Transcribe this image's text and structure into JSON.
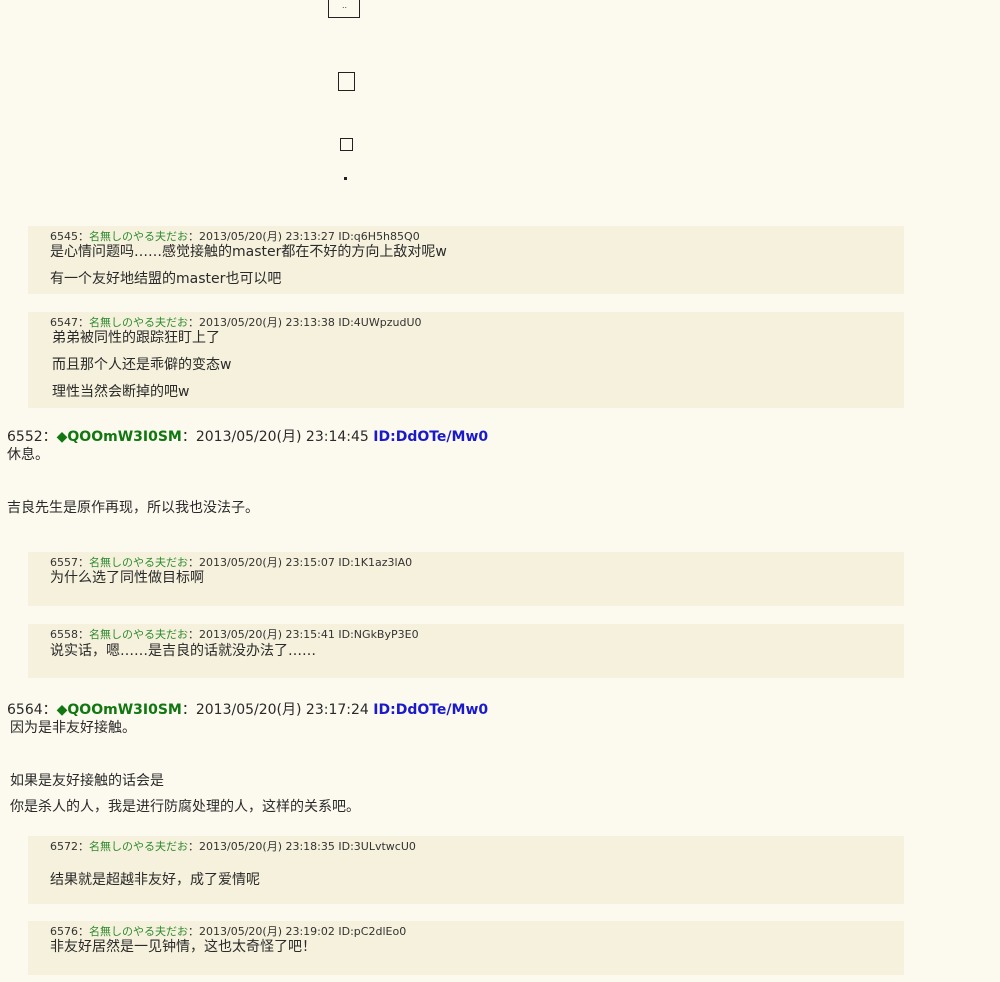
{
  "responses": [
    {
      "num": "6545",
      "name": "名無しのやる夫だお",
      "datetime": "2013/05/20(月) 23:13:27",
      "id": "ID:q6H5h85Q0",
      "lines": [
        "是心情问题吗……感觉接触的master都在不好的方向上敌对呢w",
        "有一个友好地结盟的master也可以吧"
      ]
    },
    {
      "num": "6547",
      "name": "名無しのやる夫だお",
      "datetime": "2013/05/20(月) 23:13:38",
      "id": "ID:4UWpzudU0",
      "lines": [
        "弟弟被同性的跟踪狂盯上了",
        "而且那个人还是乖僻的变态w",
        "理性当然会断掉的吧w"
      ]
    },
    {
      "num": "6557",
      "name": "名無しのやる夫だお",
      "datetime": "2013/05/20(月) 23:15:07",
      "id": "ID:1K1az3lA0",
      "lines": [
        "为什么选了同性做目标啊"
      ]
    },
    {
      "num": "6558",
      "name": "名無しのやる夫だお",
      "datetime": "2013/05/20(月) 23:15:41",
      "id": "ID:NGkByP3E0",
      "lines": [
        "说实话，嗯……是吉良的话就没办法了……"
      ]
    },
    {
      "num": "6572",
      "name": "名無しのやる夫だお",
      "datetime": "2013/05/20(月) 23:18:35",
      "id": "ID:3ULvtwcU0",
      "lines": [
        "结果就是超越非友好，成了爱情呢"
      ]
    },
    {
      "num": "6576",
      "name": "名無しのやる夫だお",
      "datetime": "2013/05/20(月) 23:19:02",
      "id": "ID:pC2dlEo0",
      "lines": [
        "非友好居然是一见钟情，这也太奇怪了吧！"
      ]
    }
  ],
  "posts": [
    {
      "num": "6552",
      "trip": "◆QOOmW3I0SM",
      "datetime": "2013/05/20(月) 23:14:45",
      "id": "ID:DdOTe/Mw0",
      "lines": [
        "休息。",
        "吉良先生是原作再现，所以我也没法子。"
      ]
    },
    {
      "num": "6564",
      "trip": "◆QOOmW3I0SM",
      "datetime": "2013/05/20(月) 23:17:24",
      "id": "ID:DdOTe/Mw0",
      "lines": [
        "因为是非友好接触。",
        "如果是友好接触的话会是",
        "你是杀人的人，我是进行防腐处理的人，这样的关系吧。"
      ]
    }
  ],
  "sep": "：",
  "dots": ".."
}
